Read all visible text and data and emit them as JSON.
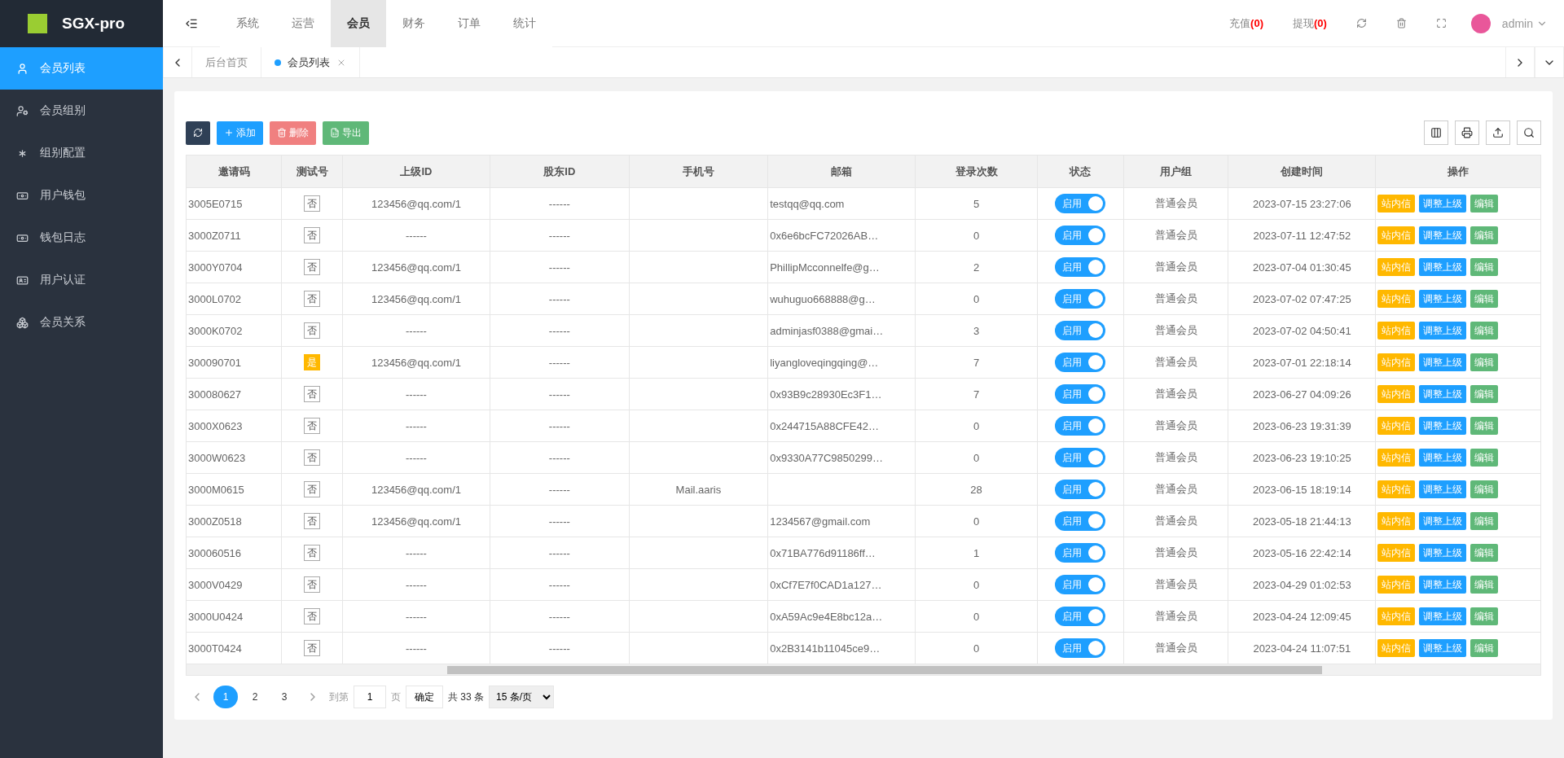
{
  "brand": "SGX-pro",
  "sidebar": {
    "items": [
      {
        "label": "会员列表",
        "selected": true
      },
      {
        "label": "会员组别",
        "selected": false
      },
      {
        "label": "组别配置",
        "selected": false
      },
      {
        "label": "用户钱包",
        "selected": false
      },
      {
        "label": "钱包日志",
        "selected": false
      },
      {
        "label": "用户认证",
        "selected": false
      },
      {
        "label": "会员关系",
        "selected": false
      }
    ]
  },
  "topnav": [
    {
      "label": "系统",
      "selected": false
    },
    {
      "label": "运营",
      "selected": false
    },
    {
      "label": "会员",
      "selected": true
    },
    {
      "label": "财务",
      "selected": false
    },
    {
      "label": "订单",
      "selected": false
    },
    {
      "label": "统计",
      "selected": false
    }
  ],
  "header_right": {
    "recharge": {
      "label": "充值",
      "count": "(0)"
    },
    "withdraw": {
      "label": "提现",
      "count": "(0)"
    },
    "user": "admin"
  },
  "page_tabs": [
    {
      "label": "后台首页",
      "selected": false
    },
    {
      "label": "会员列表",
      "selected": true
    }
  ],
  "toolbar": {
    "add": "添加",
    "delete": "删除",
    "export": "导出"
  },
  "table": {
    "columns": [
      "邀请码",
      "测试号",
      "上级ID",
      "股东ID",
      "手机号",
      "邮箱",
      "登录次数",
      "状态",
      "用户组",
      "创建时间",
      "操作"
    ],
    "rows": [
      {
        "code": "3005E0715",
        "test": {
          "label": "否",
          "on": false
        },
        "parent": "123456@qq.com/1",
        "holder": "------",
        "phone": "",
        "email": "testqq@qq.com",
        "logins": "5",
        "status": {
          "label": "启用",
          "on": true
        },
        "group": "普通会员",
        "created": "2023-07-15 23:27:06",
        "actions": [
          "站内信",
          "调整上级",
          "编辑"
        ]
      },
      {
        "code": "3000Z0711",
        "test": {
          "label": "否",
          "on": false
        },
        "parent": "------",
        "holder": "------",
        "phone": "",
        "email": "0x6e6bcFC72026AB…",
        "logins": "0",
        "status": {
          "label": "启用",
          "on": true
        },
        "group": "普通会员",
        "created": "2023-07-11 12:47:52",
        "actions": [
          "站内信",
          "调整上级",
          "编辑"
        ]
      },
      {
        "code": "3000Y0704",
        "test": {
          "label": "否",
          "on": false
        },
        "parent": "123456@qq.com/1",
        "holder": "------",
        "phone": "",
        "email": "PhillipMcconnelfe@g…",
        "logins": "2",
        "status": {
          "label": "启用",
          "on": true
        },
        "group": "普通会员",
        "created": "2023-07-04 01:30:45",
        "actions": [
          "站内信",
          "调整上级",
          "编辑"
        ]
      },
      {
        "code": "3000L0702",
        "test": {
          "label": "否",
          "on": false
        },
        "parent": "123456@qq.com/1",
        "holder": "------",
        "phone": "",
        "email": "wuhuguo668888@g…",
        "logins": "0",
        "status": {
          "label": "启用",
          "on": true
        },
        "group": "普通会员",
        "created": "2023-07-02 07:47:25",
        "actions": [
          "站内信",
          "调整上级",
          "编辑"
        ]
      },
      {
        "code": "3000K0702",
        "test": {
          "label": "否",
          "on": false
        },
        "parent": "------",
        "holder": "------",
        "phone": "",
        "email": "adminjasf0388@gmai…",
        "logins": "3",
        "status": {
          "label": "启用",
          "on": true
        },
        "group": "普通会员",
        "created": "2023-07-02 04:50:41",
        "actions": [
          "站内信",
          "调整上级",
          "编辑"
        ]
      },
      {
        "code": "300090701",
        "test": {
          "label": "是",
          "on": true
        },
        "parent": "123456@qq.com/1",
        "holder": "------",
        "phone": "",
        "email": "liyangloveqingqing@…",
        "logins": "7",
        "status": {
          "label": "启用",
          "on": true
        },
        "group": "普通会员",
        "created": "2023-07-01 22:18:14",
        "actions": [
          "站内信",
          "调整上级",
          "编辑"
        ]
      },
      {
        "code": "300080627",
        "test": {
          "label": "否",
          "on": false
        },
        "parent": "------",
        "holder": "------",
        "phone": "",
        "email": "0x93B9c28930Ec3F1…",
        "logins": "7",
        "status": {
          "label": "启用",
          "on": true
        },
        "group": "普通会员",
        "created": "2023-06-27 04:09:26",
        "actions": [
          "站内信",
          "调整上级",
          "编辑"
        ]
      },
      {
        "code": "3000X0623",
        "test": {
          "label": "否",
          "on": false
        },
        "parent": "------",
        "holder": "------",
        "phone": "",
        "email": "0x244715A88CFE42…",
        "logins": "0",
        "status": {
          "label": "启用",
          "on": true
        },
        "group": "普通会员",
        "created": "2023-06-23 19:31:39",
        "actions": [
          "站内信",
          "调整上级",
          "编辑"
        ]
      },
      {
        "code": "3000W0623",
        "test": {
          "label": "否",
          "on": false
        },
        "parent": "------",
        "holder": "------",
        "phone": "",
        "email": "0x9330A77C9850299…",
        "logins": "0",
        "status": {
          "label": "启用",
          "on": true
        },
        "group": "普通会员",
        "created": "2023-06-23 19:10:25",
        "actions": [
          "站内信",
          "调整上级",
          "编辑"
        ]
      },
      {
        "code": "3000M0615",
        "test": {
          "label": "否",
          "on": false
        },
        "parent": "123456@qq.com/1",
        "holder": "------",
        "phone": "Mail.aaris",
        "email": "",
        "logins": "28",
        "status": {
          "label": "启用",
          "on": true
        },
        "group": "普通会员",
        "created": "2023-06-15 18:19:14",
        "actions": [
          "站内信",
          "调整上级",
          "编辑"
        ]
      },
      {
        "code": "3000Z0518",
        "test": {
          "label": "否",
          "on": false
        },
        "parent": "123456@qq.com/1",
        "holder": "------",
        "phone": "",
        "email": "1234567@gmail.com",
        "logins": "0",
        "status": {
          "label": "启用",
          "on": true
        },
        "group": "普通会员",
        "created": "2023-05-18 21:44:13",
        "actions": [
          "站内信",
          "调整上级",
          "编辑"
        ]
      },
      {
        "code": "300060516",
        "test": {
          "label": "否",
          "on": false
        },
        "parent": "------",
        "holder": "------",
        "phone": "",
        "email": "0x71BA776d91186ff…",
        "logins": "1",
        "status": {
          "label": "启用",
          "on": true
        },
        "group": "普通会员",
        "created": "2023-05-16 22:42:14",
        "actions": [
          "站内信",
          "调整上级",
          "编辑"
        ]
      },
      {
        "code": "3000V0429",
        "test": {
          "label": "否",
          "on": false
        },
        "parent": "------",
        "holder": "------",
        "phone": "",
        "email": "0xCf7E7f0CAD1a127…",
        "logins": "0",
        "status": {
          "label": "启用",
          "on": true
        },
        "group": "普通会员",
        "created": "2023-04-29 01:02:53",
        "actions": [
          "站内信",
          "调整上级",
          "编辑"
        ]
      },
      {
        "code": "3000U0424",
        "test": {
          "label": "否",
          "on": false
        },
        "parent": "------",
        "holder": "------",
        "phone": "",
        "email": "0xA59Ac9e4E8bc12a…",
        "logins": "0",
        "status": {
          "label": "启用",
          "on": true
        },
        "group": "普通会员",
        "created": "2023-04-24 12:09:45",
        "actions": [
          "站内信",
          "调整上级",
          "编辑"
        ]
      },
      {
        "code": "3000T0424",
        "test": {
          "label": "否",
          "on": false
        },
        "parent": "------",
        "holder": "------",
        "phone": "",
        "email": "0x2B3141b11045ce9…",
        "logins": "0",
        "status": {
          "label": "启用",
          "on": true
        },
        "group": "普通会员",
        "created": "2023-04-24 11:07:51",
        "actions": [
          "站内信",
          "调整上级",
          "编辑"
        ]
      }
    ]
  },
  "pagination": {
    "pages": [
      {
        "label": "1",
        "selected": true
      },
      {
        "label": "2",
        "selected": false
      },
      {
        "label": "3",
        "selected": false
      }
    ],
    "goto_label": "到第",
    "goto_value": "1",
    "page_unit": "页",
    "confirm": "确定",
    "total": "共 33 条",
    "page_size": "15 条/页"
  }
}
